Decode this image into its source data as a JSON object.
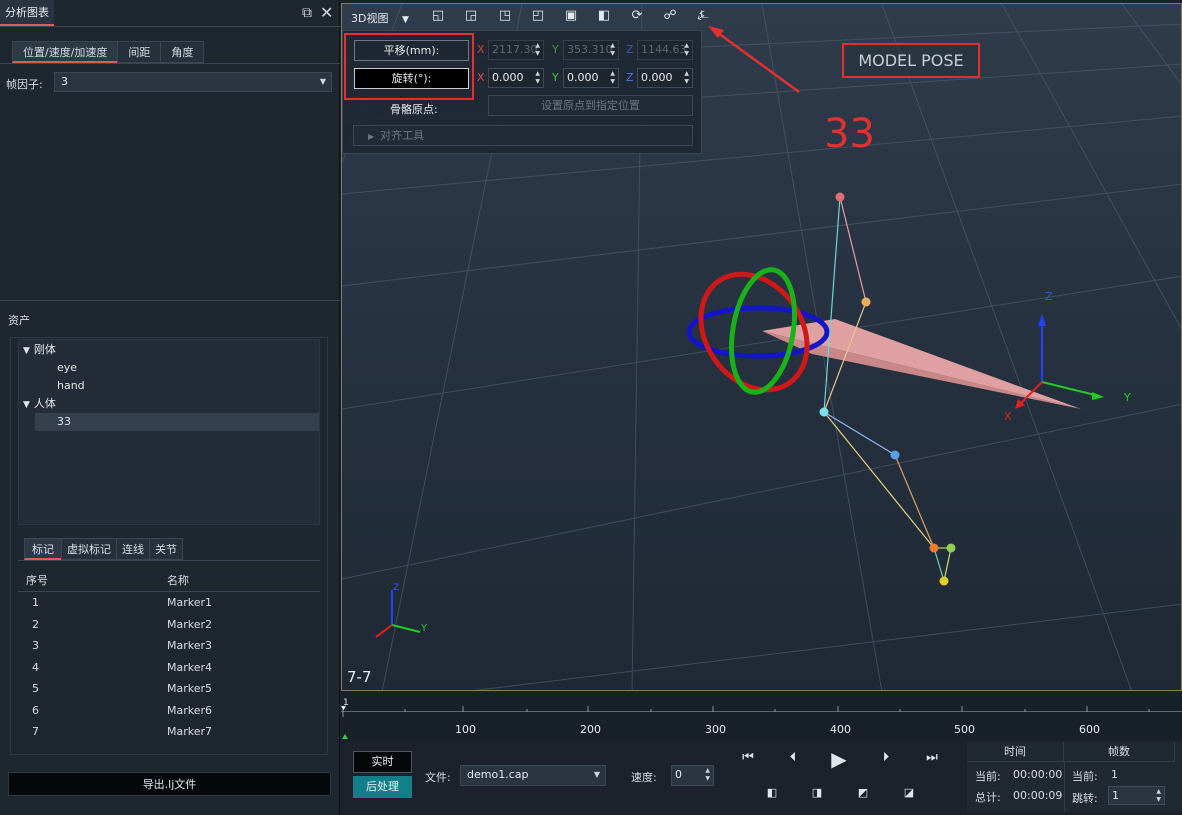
{
  "left_panel": {
    "title": "分析图表",
    "restore_icon": "restore-window-icon",
    "close_icon": "close-icon",
    "tabs": [
      "位置/速度/加速度",
      "间距",
      "角度"
    ],
    "frame_factor_label": "帧因子:",
    "frame_factor_value": "3",
    "assets_label": "资产",
    "tree": [
      {
        "label": "刚体",
        "level": 0,
        "expanded": true
      },
      {
        "label": "eye",
        "level": 1
      },
      {
        "label": "hand",
        "level": 1
      },
      {
        "label": "人体",
        "level": 0,
        "expanded": true
      },
      {
        "label": "33",
        "level": 1,
        "selected": true
      }
    ],
    "list_tabs": [
      "标记",
      "虚拟标记",
      "连线",
      "关节"
    ],
    "table_headers": [
      "序号",
      "名称"
    ],
    "table_rows": [
      [
        "1",
        "Marker1"
      ],
      [
        "2",
        "Marker2"
      ],
      [
        "3",
        "Marker3"
      ],
      [
        "4",
        "Marker4"
      ],
      [
        "5",
        "Marker5"
      ],
      [
        "6",
        "Marker6"
      ],
      [
        "7",
        "Marker7"
      ]
    ],
    "export_label": "导出.lj文件"
  },
  "viewport": {
    "view_mode": "3D视图",
    "pose": {
      "translate_label": "平移(mm):",
      "rotate_label": "旋转(°):",
      "translate": {
        "x": "2117.30",
        "y": "353.310",
        "z": "1144.63"
      },
      "rotate": {
        "x": "0.000",
        "y": "0.000",
        "z": "0.000"
      },
      "origin_label": "骨骼原点:",
      "origin_button": "设置原点到指定位置",
      "align_tools": "对齐工具"
    },
    "annotation_label": "MODEL POSE",
    "selected_name": "33",
    "frame_range": "7-7",
    "axis_labels": {
      "x": "X",
      "y": "Y",
      "z": "Z"
    }
  },
  "timeline": {
    "start_frame": "1",
    "ticks": [
      "100",
      "200",
      "300",
      "400",
      "500",
      "600"
    ]
  },
  "playback": {
    "realtime_label": "实时",
    "postprocess_label": "后处理",
    "file_label": "文件:",
    "file_value": "demo1.cap",
    "speed_label": "速度:",
    "speed_value": "0",
    "time_header": "时间",
    "frames_header": "帧数",
    "current_label": "当前:",
    "total_label": "总计:",
    "current_time": "00:00:00",
    "total_time": "00:00:09",
    "current_frame": "1",
    "jump_label": "跳转:",
    "jump_value": "1"
  }
}
